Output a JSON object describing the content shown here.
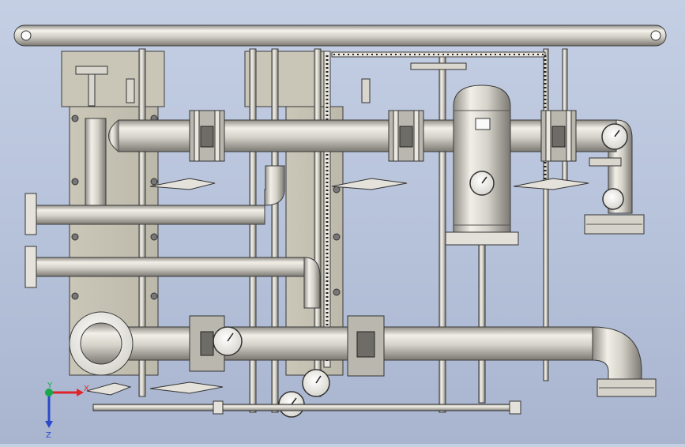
{
  "viewport": {
    "background_top": "#c4cfe4",
    "background_bottom": "#a9b5cf",
    "model_color": "#cfcdc3",
    "edge_color": "#3a3a3a"
  },
  "triad": {
    "x_label": "X",
    "y_label": "Y",
    "z_label": "Z",
    "x_color": "#e0242a",
    "y_color": "#18a84a",
    "z_color": "#2a48c8"
  }
}
